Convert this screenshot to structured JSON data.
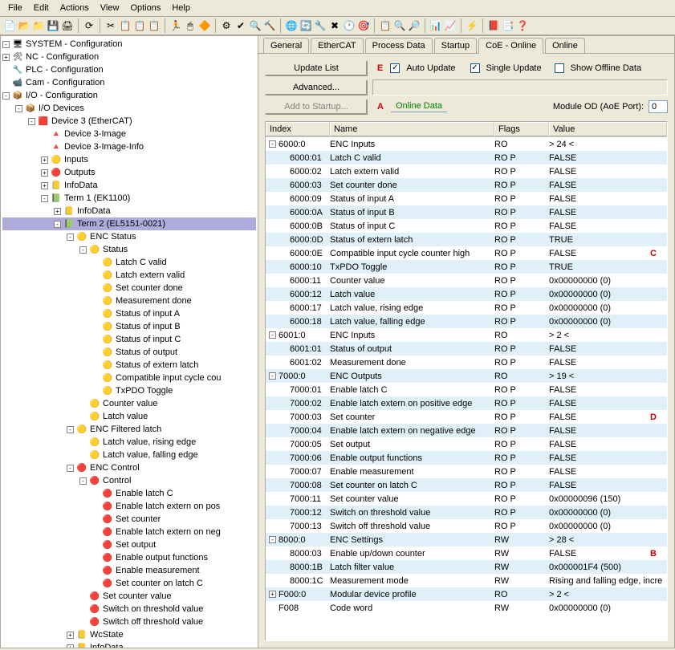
{
  "menu": [
    "File",
    "Edit",
    "Actions",
    "View",
    "Options",
    "Help"
  ],
  "tree": [
    {
      "d": 0,
      "pm": "-",
      "ico": "🖥",
      "t": "SYSTEM - Configuration"
    },
    {
      "d": 0,
      "pm": "+",
      "ico": "🛠",
      "t": "NC - Configuration"
    },
    {
      "d": 0,
      "pm": " ",
      "ico": "🔧",
      "t": "PLC - Configuration"
    },
    {
      "d": 0,
      "pm": " ",
      "ico": "📹",
      "t": "Cam - Configuration"
    },
    {
      "d": 0,
      "pm": "-",
      "ico": "📦",
      "t": "I/O - Configuration"
    },
    {
      "d": 1,
      "pm": "-",
      "ico": "📦",
      "t": "I/O Devices"
    },
    {
      "d": 2,
      "pm": "-",
      "ico": "🟥",
      "t": "Device 3 (EtherCAT)"
    },
    {
      "d": 3,
      "pm": " ",
      "ico": "🔺",
      "t": "Device 3-Image"
    },
    {
      "d": 3,
      "pm": " ",
      "ico": "🔺",
      "t": "Device 3-Image-Info"
    },
    {
      "d": 3,
      "pm": "+",
      "ico": "🟡",
      "t": "Inputs"
    },
    {
      "d": 3,
      "pm": "+",
      "ico": "🔴",
      "t": "Outputs"
    },
    {
      "d": 3,
      "pm": "+",
      "ico": "📒",
      "t": "InfoData"
    },
    {
      "d": 3,
      "pm": "-",
      "ico": "📗",
      "t": "Term 1 (EK1100)"
    },
    {
      "d": 4,
      "pm": "+",
      "ico": "📒",
      "t": "InfoData"
    },
    {
      "d": 4,
      "pm": "-",
      "ico": "📗",
      "t": "Term 2 (EL5151-0021)",
      "sel": true
    },
    {
      "d": 5,
      "pm": "-",
      "ico": "🟡",
      "t": "ENC Status"
    },
    {
      "d": 6,
      "pm": "-",
      "ico": "🟡",
      "t": "Status"
    },
    {
      "d": 7,
      "pm": " ",
      "ico": "🟡",
      "t": "Latch C valid"
    },
    {
      "d": 7,
      "pm": " ",
      "ico": "🟡",
      "t": "Latch extern valid"
    },
    {
      "d": 7,
      "pm": " ",
      "ico": "🟡",
      "t": "Set counter done"
    },
    {
      "d": 7,
      "pm": " ",
      "ico": "🟡",
      "t": "Measurement done"
    },
    {
      "d": 7,
      "pm": " ",
      "ico": "🟡",
      "t": "Status of input A"
    },
    {
      "d": 7,
      "pm": " ",
      "ico": "🟡",
      "t": "Status of input B"
    },
    {
      "d": 7,
      "pm": " ",
      "ico": "🟡",
      "t": "Status of input C"
    },
    {
      "d": 7,
      "pm": " ",
      "ico": "🟡",
      "t": "Status of output"
    },
    {
      "d": 7,
      "pm": " ",
      "ico": "🟡",
      "t": "Status of extern latch"
    },
    {
      "d": 7,
      "pm": " ",
      "ico": "🟡",
      "t": "Compatible input cycle cou"
    },
    {
      "d": 7,
      "pm": " ",
      "ico": "🟡",
      "t": "TxPDO Toggle"
    },
    {
      "d": 6,
      "pm": " ",
      "ico": "🟡",
      "t": "Counter value"
    },
    {
      "d": 6,
      "pm": " ",
      "ico": "🟡",
      "t": "Latch value"
    },
    {
      "d": 5,
      "pm": "-",
      "ico": "🟡",
      "t": "ENC Filtered latch"
    },
    {
      "d": 6,
      "pm": " ",
      "ico": "🟡",
      "t": "Latch value, rising edge"
    },
    {
      "d": 6,
      "pm": " ",
      "ico": "🟡",
      "t": "Latch value, falling edge"
    },
    {
      "d": 5,
      "pm": "-",
      "ico": "🔴",
      "t": "ENC Control"
    },
    {
      "d": 6,
      "pm": "-",
      "ico": "🔴",
      "t": "Control"
    },
    {
      "d": 7,
      "pm": " ",
      "ico": "🔴",
      "t": "Enable latch C"
    },
    {
      "d": 7,
      "pm": " ",
      "ico": "🔴",
      "t": "Enable latch extern on pos"
    },
    {
      "d": 7,
      "pm": " ",
      "ico": "🔴",
      "t": "Set counter"
    },
    {
      "d": 7,
      "pm": " ",
      "ico": "🔴",
      "t": "Enable latch extern on neg"
    },
    {
      "d": 7,
      "pm": " ",
      "ico": "🔴",
      "t": "Set output"
    },
    {
      "d": 7,
      "pm": " ",
      "ico": "🔴",
      "t": "Enable output functions"
    },
    {
      "d": 7,
      "pm": " ",
      "ico": "🔴",
      "t": "Enable measurement"
    },
    {
      "d": 7,
      "pm": " ",
      "ico": "🔴",
      "t": "Set counter on latch C"
    },
    {
      "d": 6,
      "pm": " ",
      "ico": "🔴",
      "t": "Set counter value"
    },
    {
      "d": 6,
      "pm": " ",
      "ico": "🔴",
      "t": "Switch on threshold value"
    },
    {
      "d": 6,
      "pm": " ",
      "ico": "🔴",
      "t": "Switch off threshold value"
    },
    {
      "d": 5,
      "pm": "+",
      "ico": "📒",
      "t": "WcState"
    },
    {
      "d": 5,
      "pm": "+",
      "ico": "📒",
      "t": "InfoData"
    }
  ],
  "tabs": [
    "General",
    "EtherCAT",
    "Process Data",
    "Startup",
    "CoE - Online",
    "Online"
  ],
  "activeTab": 4,
  "btn": {
    "updateList": "Update List",
    "advanced": "Advanced...",
    "addStartup": "Add to Startup..."
  },
  "opts": {
    "autoUpdate": "Auto Update",
    "singleUpdate": "Single Update",
    "offline": "Show Offline Data",
    "onlineData": "Online Data",
    "moduleOD": "Module OD (AoE Port):",
    "modVal": "0"
  },
  "annot": {
    "A": "A",
    "B": "B",
    "C": "C",
    "D": "D",
    "E": "E"
  },
  "gridHead": {
    "index": "Index",
    "name": "Name",
    "flags": "Flags",
    "value": "Value"
  },
  "grid": [
    {
      "pm": "-",
      "d": 0,
      "idx": "6000:0",
      "nm": "ENC Inputs",
      "fl": "RO",
      "val": "> 24 <",
      "a": 0
    },
    {
      "pm": " ",
      "d": 1,
      "idx": "6000:01",
      "nm": "Latch C valid",
      "fl": "RO P",
      "val": "FALSE",
      "a": 1
    },
    {
      "pm": " ",
      "d": 1,
      "idx": "6000:02",
      "nm": "Latch extern valid",
      "fl": "RO P",
      "val": "FALSE",
      "a": 0
    },
    {
      "pm": " ",
      "d": 1,
      "idx": "6000:03",
      "nm": "Set counter done",
      "fl": "RO P",
      "val": "FALSE",
      "a": 1
    },
    {
      "pm": " ",
      "d": 1,
      "idx": "6000:09",
      "nm": "Status of input A",
      "fl": "RO P",
      "val": "FALSE",
      "a": 0
    },
    {
      "pm": " ",
      "d": 1,
      "idx": "6000:0A",
      "nm": "Status of input B",
      "fl": "RO P",
      "val": "FALSE",
      "a": 1
    },
    {
      "pm": " ",
      "d": 1,
      "idx": "6000:0B",
      "nm": "Status of input C",
      "fl": "RO P",
      "val": "FALSE",
      "a": 0
    },
    {
      "pm": " ",
      "d": 1,
      "idx": "6000:0D",
      "nm": "Status of extern latch",
      "fl": "RO P",
      "val": "TRUE",
      "a": 1
    },
    {
      "pm": " ",
      "d": 1,
      "idx": "6000:0E",
      "nm": "Compatible input cycle counter high",
      "fl": "RO P",
      "val": "FALSE",
      "a": 0,
      "red": "C"
    },
    {
      "pm": " ",
      "d": 1,
      "idx": "6000:10",
      "nm": "TxPDO Toggle",
      "fl": "RO P",
      "val": "TRUE",
      "a": 1
    },
    {
      "pm": " ",
      "d": 1,
      "idx": "6000:11",
      "nm": "Counter value",
      "fl": "RO P",
      "val": "0x00000000 (0)",
      "a": 0
    },
    {
      "pm": " ",
      "d": 1,
      "idx": "6000:12",
      "nm": "Latch value",
      "fl": "RO P",
      "val": "0x00000000 (0)",
      "a": 1
    },
    {
      "pm": " ",
      "d": 1,
      "idx": "6000:17",
      "nm": "Latch value, rising edge",
      "fl": "RO P",
      "val": "0x00000000 (0)",
      "a": 0
    },
    {
      "pm": " ",
      "d": 1,
      "idx": "6000:18",
      "nm": "Latch value, falling edge",
      "fl": "RO P",
      "val": "0x00000000 (0)",
      "a": 1
    },
    {
      "pm": "-",
      "d": 0,
      "idx": "6001:0",
      "nm": "ENC Inputs",
      "fl": "RO",
      "val": "> 2 <",
      "a": 0
    },
    {
      "pm": " ",
      "d": 1,
      "idx": "6001:01",
      "nm": "Status of output",
      "fl": "RO P",
      "val": "FALSE",
      "a": 1
    },
    {
      "pm": " ",
      "d": 1,
      "idx": "6001:02",
      "nm": "Measurement done",
      "fl": "RO P",
      "val": "FALSE",
      "a": 0
    },
    {
      "pm": "-",
      "d": 0,
      "idx": "7000:0",
      "nm": "ENC Outputs",
      "fl": "RO",
      "val": "> 19 <",
      "a": 1
    },
    {
      "pm": " ",
      "d": 1,
      "idx": "7000:01",
      "nm": "Enable latch C",
      "fl": "RO P",
      "val": "FALSE",
      "a": 0
    },
    {
      "pm": " ",
      "d": 1,
      "idx": "7000:02",
      "nm": "Enable latch extern on positive edge",
      "fl": "RO P",
      "val": "FALSE",
      "a": 1
    },
    {
      "pm": " ",
      "d": 1,
      "idx": "7000:03",
      "nm": "Set counter",
      "fl": "RO P",
      "val": "FALSE",
      "a": 0,
      "red": "D"
    },
    {
      "pm": " ",
      "d": 1,
      "idx": "7000:04",
      "nm": "Enable latch extern on negative edge",
      "fl": "RO P",
      "val": "FALSE",
      "a": 1
    },
    {
      "pm": " ",
      "d": 1,
      "idx": "7000:05",
      "nm": "Set output",
      "fl": "RO P",
      "val": "FALSE",
      "a": 0
    },
    {
      "pm": " ",
      "d": 1,
      "idx": "7000:06",
      "nm": "Enable output functions",
      "fl": "RO P",
      "val": "FALSE",
      "a": 1
    },
    {
      "pm": " ",
      "d": 1,
      "idx": "7000:07",
      "nm": "Enable measurement",
      "fl": "RO P",
      "val": "FALSE",
      "a": 0
    },
    {
      "pm": " ",
      "d": 1,
      "idx": "7000:08",
      "nm": "Set counter on latch C",
      "fl": "RO P",
      "val": "FALSE",
      "a": 1
    },
    {
      "pm": " ",
      "d": 1,
      "idx": "7000:11",
      "nm": "Set counter value",
      "fl": "RO P",
      "val": "0x00000096 (150)",
      "a": 0
    },
    {
      "pm": " ",
      "d": 1,
      "idx": "7000:12",
      "nm": "Switch on threshold value",
      "fl": "RO P",
      "val": "0x00000000 (0)",
      "a": 1
    },
    {
      "pm": " ",
      "d": 1,
      "idx": "7000:13",
      "nm": "Switch off threshold value",
      "fl": "RO P",
      "val": "0x00000000 (0)",
      "a": 0
    },
    {
      "pm": "-",
      "d": 0,
      "idx": "8000:0",
      "nm": "ENC Settings",
      "fl": "RW",
      "val": "> 28 <",
      "a": 1
    },
    {
      "pm": " ",
      "d": 1,
      "idx": "8000:03",
      "nm": "Enable up/down counter",
      "fl": "RW",
      "val": "FALSE",
      "a": 0,
      "red": "B"
    },
    {
      "pm": " ",
      "d": 1,
      "idx": "8000:1B",
      "nm": "Latch filter value",
      "fl": "RW",
      "val": "0x000001F4 (500)",
      "a": 1
    },
    {
      "pm": " ",
      "d": 1,
      "idx": "8000:1C",
      "nm": "Measurement mode",
      "fl": "RW",
      "val": "Rising and falling edge, incre",
      "a": 0
    },
    {
      "pm": "+",
      "d": 0,
      "idx": "F000:0",
      "nm": "Modular device profile",
      "fl": "RO",
      "val": "> 2 <",
      "a": 1
    },
    {
      "pm": " ",
      "d": 0,
      "idx": "F008",
      "nm": "Code word",
      "fl": "RW",
      "val": "0x00000000 (0)",
      "a": 0
    }
  ]
}
